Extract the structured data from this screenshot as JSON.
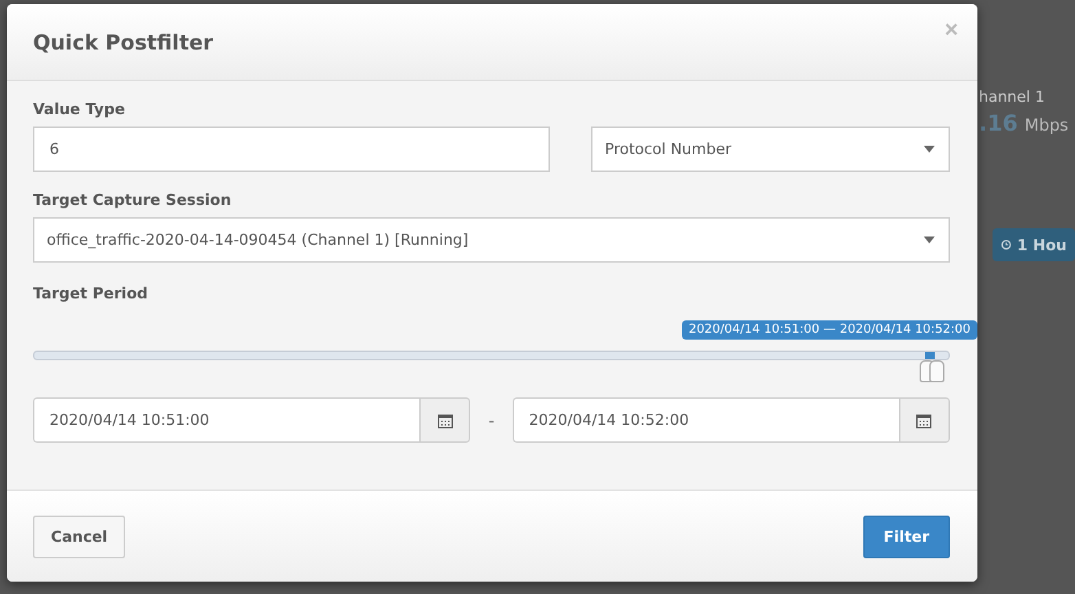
{
  "background": {
    "channel_label": "hannel 1",
    "rate_value": ".16",
    "rate_unit": "Mbps",
    "range_button": "1 Hou"
  },
  "dialog": {
    "title": "Quick Postfilter",
    "close": "×",
    "value_type": {
      "label": "Value Type",
      "value": "6",
      "type_select": "Protocol Number"
    },
    "session": {
      "label": "Target Capture Session",
      "value": "office_traffic-2020-04-14-090454 (Channel 1) [Running]"
    },
    "period": {
      "label": "Target Period",
      "tooltip": "2020/04/14 10:51:00 — 2020/04/14 10:52:00",
      "handles": [
        {
          "level": 0.975
        },
        {
          "level": 0.985
        }
      ],
      "start": "2020/04/14 10:51:00",
      "separator": "-",
      "end": "2020/04/14 10:52:00"
    },
    "buttons": [
      {
        "label": "Cancel",
        "kind": "default"
      },
      {
        "label": "Filter",
        "kind": "primary"
      }
    ]
  }
}
